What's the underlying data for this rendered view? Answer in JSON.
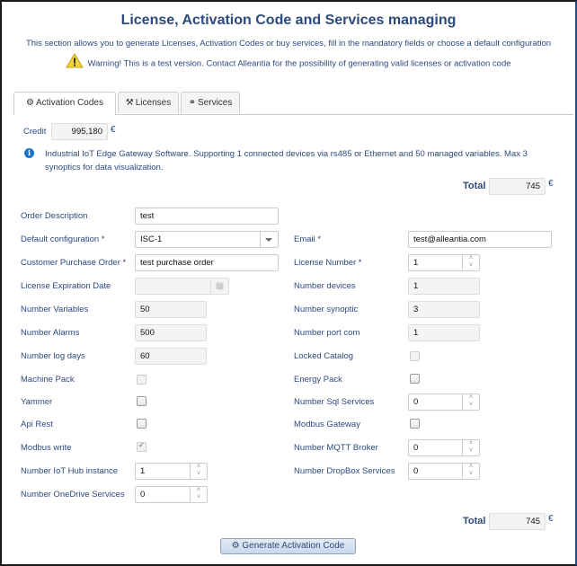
{
  "header": {
    "title": "License, Activation Code and Services managing",
    "subtitle": "This section allows you to generate Licenses, Activation Codes or buy services, fill in the mandatory fields or choose a default configuration",
    "warning": "Warning! This is a test version. Contact Alleantia for the possibility of generating valid licenses or activation code"
  },
  "tabs": [
    {
      "label": "Activation Codes",
      "icon": "cogs-icon",
      "active": true
    },
    {
      "label": "Licenses",
      "icon": "gavel-icon",
      "active": false
    },
    {
      "label": "Services",
      "icon": "link-icon",
      "active": false
    }
  ],
  "credit": {
    "label": "Credit",
    "value": "995,180",
    "currency": "€"
  },
  "info": "Industrial IoT Edge Gateway Software. Supporting 1 connected devices via rs485 or Ethernet and 50 managed variables. Max 3 synoptics for data visualization.",
  "total_top": {
    "label": "Total",
    "value": "745",
    "currency": "€"
  },
  "form": {
    "order_description": {
      "label": "Order Description",
      "value": "test"
    },
    "default_configuration": {
      "label": "Default configuration *",
      "value": "ISC-1"
    },
    "customer_po": {
      "label": "Customer Purchase Order *",
      "value": "test purchase order"
    },
    "license_expiration": {
      "label": "License Expiration Date",
      "value": ""
    },
    "number_variables": {
      "label": "Number Variables",
      "value": "50"
    },
    "number_alarms": {
      "label": "Number Alarms",
      "value": "500"
    },
    "number_log_days": {
      "label": "Number log days",
      "value": "60"
    },
    "machine_pack": {
      "label": "Machine Pack",
      "checked": false
    },
    "yammer": {
      "label": "Yammer",
      "checked": false
    },
    "api_rest": {
      "label": "Api Rest",
      "checked": false
    },
    "modbus_write": {
      "label": "Modbus write",
      "checked": true
    },
    "iot_hub": {
      "label": "Number IoT Hub instance",
      "value": "1"
    },
    "onedrive": {
      "label": "Number OneDrive Services",
      "value": "0"
    },
    "email": {
      "label": "Email *",
      "value": "test@alleantia.com"
    },
    "license_number": {
      "label": "License Number *",
      "value": "1"
    },
    "number_devices": {
      "label": "Number devices",
      "value": "1"
    },
    "number_synoptic": {
      "label": "Number synoptic",
      "value": "3"
    },
    "number_port_com": {
      "label": "Number port com",
      "value": "1"
    },
    "locked_catalog": {
      "label": "Locked Catalog",
      "checked": false
    },
    "energy_pack": {
      "label": "Energy Pack",
      "checked": false
    },
    "sql_services": {
      "label": "Number Sql Services",
      "value": "0"
    },
    "modbus_gateway": {
      "label": "Modbus Gateway",
      "checked": false
    },
    "mqtt_broker": {
      "label": "Number MQTT Broker",
      "value": "0"
    },
    "dropbox": {
      "label": "Number DropBox Services",
      "value": "0"
    }
  },
  "total_bottom": {
    "label": "Total",
    "value": "745",
    "currency": "€"
  },
  "generate_button": {
    "label": "Generate Activation Code"
  }
}
